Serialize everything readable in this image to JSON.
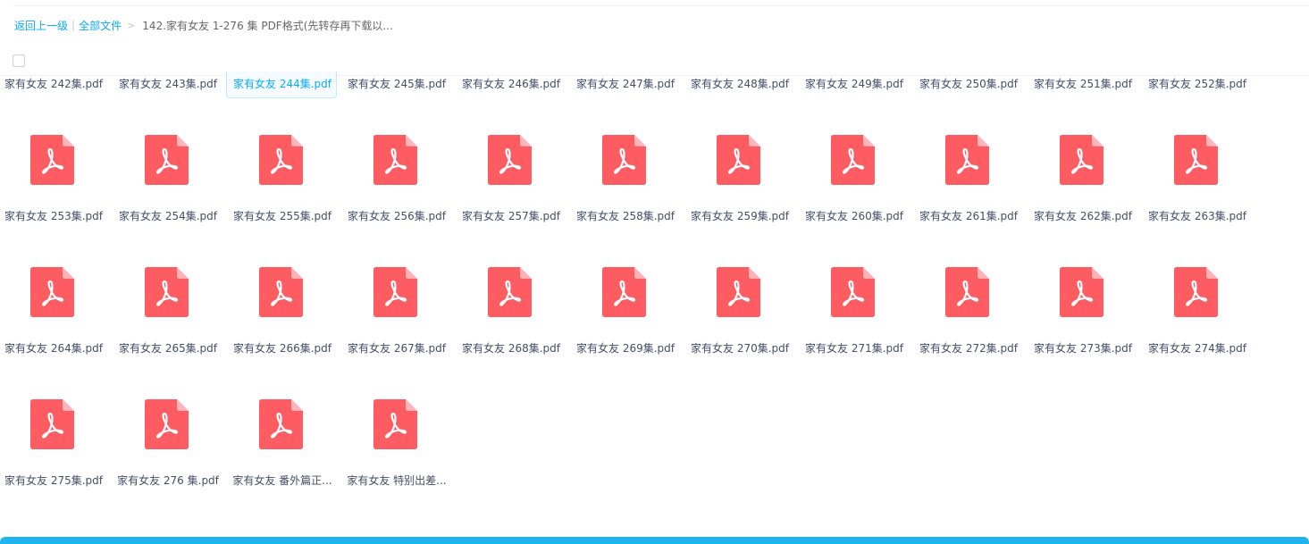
{
  "breadcrumb": {
    "back": "返回上一级",
    "divider": "|",
    "all_files": "全部文件",
    "arrow": ">",
    "current": "142.家有女友 1-276 集 PDF格式(先转存再下载以..."
  },
  "colors": {
    "accent": "#09aaff",
    "pdf_icon": "#fd5c63",
    "bottom_bar": "#1fb3ef"
  },
  "icon": "pdf-file-icon",
  "files": [
    "家有女友 242集.pdf",
    "家有女友 243集.pdf",
    "家有女友 244集.pdf",
    "家有女友 245集.pdf",
    "家有女友 246集.pdf",
    "家有女友 247集.pdf",
    "家有女友 248集.pdf",
    "家有女友 249集.pdf",
    "家有女友 250集.pdf",
    "家有女友 251集.pdf",
    "家有女友 252集.pdf",
    "家有女友 253集.pdf",
    "家有女友 254集.pdf",
    "家有女友 255集.pdf",
    "家有女友 256集.pdf",
    "家有女友 257集.pdf",
    "家有女友 258集.pdf",
    "家有女友 259集.pdf",
    "家有女友 260集.pdf",
    "家有女友 261集.pdf",
    "家有女友 262集.pdf",
    "家有女友 263集.pdf",
    "家有女友 264集.pdf",
    "家有女友 265集.pdf",
    "家有女友 266集.pdf",
    "家有女友 267集.pdf",
    "家有女友 268集.pdf",
    "家有女友 269集.pdf",
    "家有女友 270集.pdf",
    "家有女友 271集.pdf",
    "家有女友 272集.pdf",
    "家有女友 273集.pdf",
    "家有女友 274集.pdf",
    "家有女友 275集.pdf",
    "家有女友 276 集.pdf",
    "家有女友 番外篇正...",
    "家有女友 特别出差..."
  ],
  "selected_index": 2
}
